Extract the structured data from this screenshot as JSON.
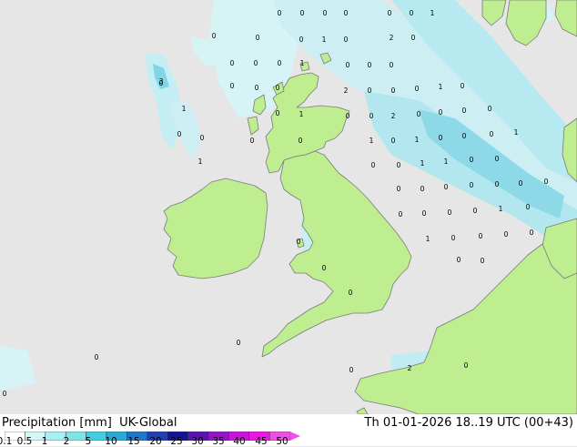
{
  "header": {
    "product": "Precipitation [mm]",
    "model": "UK-Global",
    "valid_time": "Th 01-01-2026 18..19 UTC (00+43)"
  },
  "legend": {
    "ticks": [
      "0.1",
      "0.5",
      "1",
      "2",
      "5",
      "10",
      "15",
      "20",
      "25",
      "30",
      "35",
      "40",
      "45",
      "50"
    ],
    "colors": [
      "#ffffff",
      "#d4f6f8",
      "#a8eef2",
      "#7ee4ea",
      "#40cee0",
      "#2aaad4",
      "#1e78c8",
      "#1e40b4",
      "#141496",
      "#5a14b4",
      "#9614c8",
      "#c814dc",
      "#f014e6",
      "#f04ee6"
    ]
  },
  "palette": {
    "sea": "#e6e6e6",
    "land": "#bfee90",
    "coast": "#7a7a7a",
    "rain_light": "#c8f0f4",
    "rain_moderate": "#98e0ec",
    "rain_heavy": "#60cce0"
  },
  "map_labels": [
    {
      "v": "0"
    },
    {
      "v": "0"
    },
    {
      "v": "0"
    },
    {
      "v": "0"
    },
    {
      "v": "0"
    },
    {
      "v": "0"
    },
    {
      "v": "1"
    },
    {
      "v": "0"
    },
    {
      "v": "0"
    },
    {
      "v": "0"
    },
    {
      "v": "1"
    },
    {
      "v": "0"
    },
    {
      "v": "2"
    },
    {
      "v": "0"
    },
    {
      "v": "0"
    },
    {
      "v": "0"
    },
    {
      "v": "0"
    },
    {
      "v": "1"
    },
    {
      "v": "0"
    },
    {
      "v": "0"
    },
    {
      "v": "0"
    },
    {
      "v": "3"
    },
    {
      "v": "0"
    },
    {
      "v": "0"
    },
    {
      "v": "0"
    },
    {
      "v": "2"
    },
    {
      "v": "0"
    },
    {
      "v": "0"
    },
    {
      "v": "0"
    },
    {
      "v": "1"
    },
    {
      "v": "0"
    },
    {
      "v": "0"
    },
    {
      "v": "1"
    },
    {
      "v": "0"
    },
    {
      "v": "1"
    },
    {
      "v": "0"
    },
    {
      "v": "0"
    },
    {
      "v": "2"
    },
    {
      "v": "0"
    },
    {
      "v": "0"
    },
    {
      "v": "0"
    },
    {
      "v": "0"
    },
    {
      "v": "0"
    },
    {
      "v": "0"
    },
    {
      "v": "0"
    },
    {
      "v": "0"
    },
    {
      "v": "1"
    },
    {
      "v": "0"
    },
    {
      "v": "1"
    },
    {
      "v": "0"
    },
    {
      "v": "0"
    },
    {
      "v": "0"
    },
    {
      "v": "1"
    },
    {
      "v": "1"
    },
    {
      "v": "0"
    },
    {
      "v": "0"
    },
    {
      "v": "1"
    },
    {
      "v": "1"
    },
    {
      "v": "0"
    },
    {
      "v": "0"
    },
    {
      "v": "0"
    },
    {
      "v": "0"
    },
    {
      "v": "0"
    },
    {
      "v": "0"
    },
    {
      "v": "0"
    },
    {
      "v": "0"
    },
    {
      "v": "0"
    },
    {
      "v": "0"
    },
    {
      "v": "0"
    },
    {
      "v": "0"
    },
    {
      "v": "0"
    },
    {
      "v": "1"
    },
    {
      "v": "0"
    },
    {
      "v": "0"
    },
    {
      "v": "1"
    },
    {
      "v": "0"
    },
    {
      "v": "0"
    },
    {
      "v": "0"
    },
    {
      "v": "0"
    },
    {
      "v": "0"
    },
    {
      "v": "0"
    },
    {
      "v": "0"
    },
    {
      "v": "0"
    },
    {
      "v": "0"
    },
    {
      "v": "0"
    },
    {
      "v": "2"
    },
    {
      "v": "0"
    },
    {
      "v": "0"
    },
    {
      "v": "0"
    }
  ]
}
